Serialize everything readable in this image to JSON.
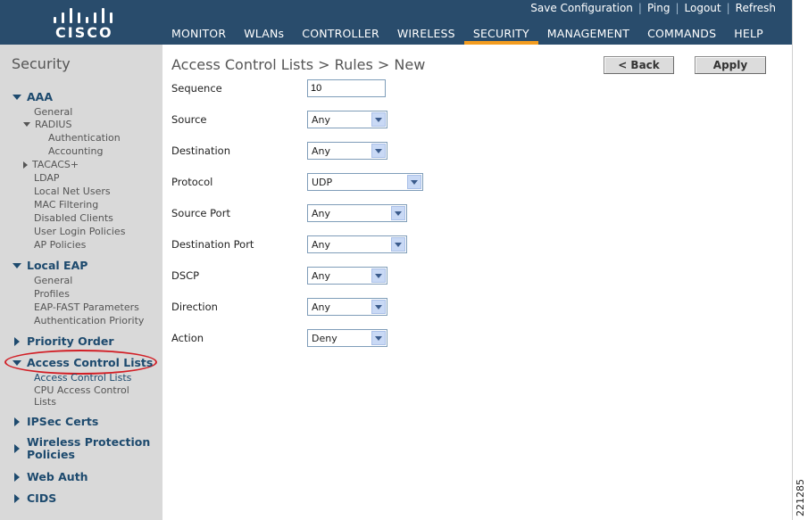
{
  "header": {
    "brand": "CISCO",
    "utility_links": [
      "Save Configuration",
      "Ping",
      "Logout",
      "Refresh"
    ],
    "nav": [
      "MONITOR",
      "WLANs",
      "CONTROLLER",
      "WIRELESS",
      "SECURITY",
      "MANAGEMENT",
      "COMMANDS",
      "HELP"
    ],
    "active_nav": "SECURITY"
  },
  "sidebar": {
    "title": "Security",
    "aaa": {
      "label": "AAA",
      "items": [
        "General",
        "RADIUS",
        "Authentication",
        "Accounting",
        "TACACS+",
        "LDAP",
        "Local Net Users",
        "MAC Filtering",
        "Disabled Clients",
        "User Login Policies",
        "AP Policies"
      ]
    },
    "local_eap": {
      "label": "Local EAP",
      "items": [
        "General",
        "Profiles",
        "EAP-FAST Parameters",
        "Authentication Priority"
      ]
    },
    "priority_order": "Priority Order",
    "acl": {
      "label": "Access Control Lists",
      "items": [
        "Access Control Lists",
        "CPU Access Control",
        "Lists"
      ]
    },
    "ipsec_certs": "IPSec Certs",
    "wireless_protection": [
      "Wireless Protection",
      "Policies"
    ],
    "web_auth": "Web Auth",
    "cids": "CIDS"
  },
  "main": {
    "title": "Access Control Lists > Rules > New",
    "back_button": "< Back",
    "apply_button": "Apply",
    "fields": {
      "sequence": {
        "label": "Sequence",
        "value": "10"
      },
      "source": {
        "label": "Source",
        "value": "Any"
      },
      "destination": {
        "label": "Destination",
        "value": "Any"
      },
      "protocol": {
        "label": "Protocol",
        "value": "UDP"
      },
      "source_port": {
        "label": "Source Port",
        "value": "Any"
      },
      "destination_port": {
        "label": "Destination Port",
        "value": "Any"
      },
      "dscp": {
        "label": "DSCP",
        "value": "Any"
      },
      "direction": {
        "label": "Direction",
        "value": "Any"
      },
      "action": {
        "label": "Action",
        "value": "Deny"
      }
    }
  },
  "figure_id": "221285",
  "colors": {
    "header_bg": "#294c6c",
    "active_tab": "#f39c1f",
    "sidebar_bg": "#d9d9d9",
    "highlight": "#d21f26"
  }
}
